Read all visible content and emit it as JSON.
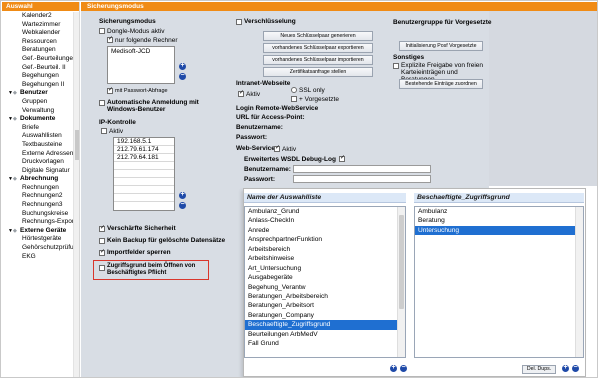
{
  "sidebar": {
    "header": "Auswahl",
    "items": [
      {
        "label": "Kalender2",
        "group": false
      },
      {
        "label": "Wartezimmer",
        "group": false
      },
      {
        "label": "Webkalender",
        "group": false
      },
      {
        "label": "Ressourcen",
        "group": false
      },
      {
        "label": "Beratungen",
        "group": false
      },
      {
        "label": "Gef.-Beurteilungen",
        "group": false
      },
      {
        "label": "Gef.-Beurteil. II",
        "group": false
      },
      {
        "label": "Begehungen",
        "group": false
      },
      {
        "label": "Begehungen II",
        "group": false
      },
      {
        "label": "Benutzer",
        "group": true
      },
      {
        "label": "Gruppen",
        "group": false
      },
      {
        "label": "Verwaltung",
        "group": false
      },
      {
        "label": "Dokumente",
        "group": true
      },
      {
        "label": "Briefe",
        "group": false
      },
      {
        "label": "Auswahllisten",
        "group": false
      },
      {
        "label": "Textbausteine",
        "group": false
      },
      {
        "label": "Externe Adressen",
        "group": false
      },
      {
        "label": "Druckvorlagen",
        "group": false
      },
      {
        "label": "Digitale Signatur",
        "group": false
      },
      {
        "label": "Abrechnung",
        "group": true
      },
      {
        "label": "Rechnungen",
        "group": false
      },
      {
        "label": "Rechnungen2",
        "group": false
      },
      {
        "label": "Rechnungen3",
        "group": false
      },
      {
        "label": "Buchungskreise",
        "group": false
      },
      {
        "label": "Rechnungs-Export",
        "group": false
      },
      {
        "label": "Externe Geräte",
        "group": true
      },
      {
        "label": "Hörtestgeräte",
        "group": false
      },
      {
        "label": "Gehörschutzprüfung",
        "group": false
      },
      {
        "label": "EKG",
        "group": false
      }
    ]
  },
  "header": {
    "title": "Sicherungsmodus"
  },
  "sicherungsmodus": {
    "title": "Sicherungsmodus",
    "dongle_label": "Dongle-Modus aktiv",
    "nur_label": "nur folgende Rechner",
    "rechner": [
      "Medisoft-JCD"
    ],
    "passwort_abfrage": "mit Passwort-Abfrage",
    "auto_anmeldung": "Automatische Anmeldung mit Windows-Benutzer"
  },
  "ip": {
    "title": "IP-Kontrolle",
    "aktiv_label": "Aktiv",
    "addresses": [
      "192.168.5.1",
      "212.79.61.174",
      "212.79.64.181"
    ]
  },
  "bottom_options": {
    "verschaerfte": "Verschärfte Sicherheit",
    "kein_backup": "Kein Backup für gelöschte Datensätze",
    "importfelder": "Importfelder sperren",
    "zugriffsgrund": "Zugriffsgrund beim Öffnen von Beschäftigtes Pflicht"
  },
  "verschluesselung": {
    "title": "Verschlüsselung",
    "btn_new": "Neues Schlüsselpaar generieren",
    "btn_export": "vorhandenes Schlüsselpaar exportieren",
    "btn_import": "vorhandenes Schlüsselpaar importieren",
    "btn_cert": "Zertifikatsanfrage stellen"
  },
  "intranet": {
    "title": "Intranet-Webseite",
    "aktiv_label": "Aktiv",
    "ssl_label": "SSL only",
    "vorgesetzte_label": "+ Vorgesetzte"
  },
  "login_remote": {
    "title": "Login Remote-WebService",
    "url_label": "URL für Access-Point:",
    "user_label": "Benutzername:",
    "pass_label": "Passwort:"
  },
  "webservices": {
    "title": "Web-Services",
    "aktiv_label": "Aktiv",
    "debug_label": "Erweitertes WSDL Debug-Log",
    "user_label": "Benutzername:",
    "pass_label": "Passwort:"
  },
  "benutzergruppe": {
    "title": "Benutzergruppe für Vorgesetzte",
    "btn_init": "Initialisierung Posf Vorgesetzte"
  },
  "sonstiges": {
    "title": "Sonstiges",
    "explizite_label": "Explizite Freigabe von freien Karteieinträgen und Beratungen",
    "btn_zuordnen": "Bestehende Einträge zuordnen"
  },
  "overlay": {
    "left_header": "Name der Auswahlliste",
    "right_header": "Beschaeftigte_Zugriffsgrund",
    "left_items": [
      "Ambulanz_Grund",
      "Anlass-CheckIn",
      "Anrede",
      "AnsprechpartnerFunktion",
      "Arbeitsbereich",
      "Arbeitshinweise",
      "Art_Untersuchung",
      "Ausgabegeräte",
      "Begehung_Verantw",
      "Beratungen_Arbeitsbereich",
      "Beratungen_Arbeitsort",
      "Beratungen_Company",
      "Beschaeftigte_Zugriffsgrund",
      "Beurteilungen ArbMedV",
      "Fall Grund"
    ],
    "left_selected_index": 12,
    "right_items": [
      "Ambulanz",
      "Beratung",
      "Untersuchung"
    ],
    "right_selected_index": 2,
    "del_button": "Del. Dups."
  },
  "colors": {
    "accent": "#f08b15",
    "panel": "#d8dde4",
    "selection": "#1f6fd1",
    "highlight": "#d9362c"
  }
}
